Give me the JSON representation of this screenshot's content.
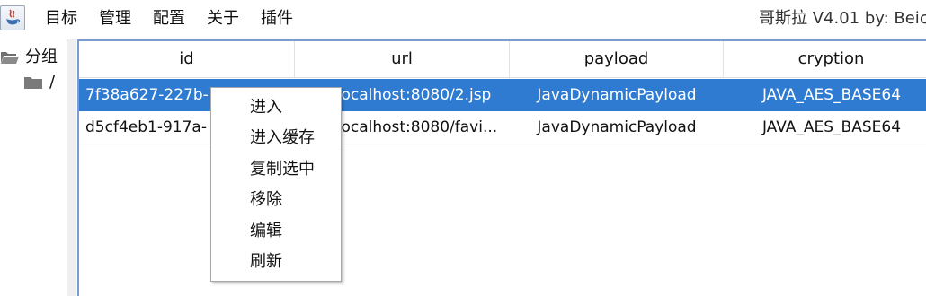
{
  "menubar": {
    "items": [
      "目标",
      "管理",
      "配置",
      "关于",
      "插件"
    ],
    "window_title": "哥斯拉   V4.01 by: Beic"
  },
  "tree": {
    "root_label": "分组",
    "child_label": "/"
  },
  "table": {
    "columns": [
      "id",
      "url",
      "payload",
      "cryption"
    ],
    "rows": [
      {
        "id": "7f38a627-227b-",
        "url": "/localhost:8080/2.jsp",
        "payload": "JavaDynamicPayload",
        "cryption": "JAVA_AES_BASE64",
        "selected": true
      },
      {
        "id": "d5cf4eb1-917a-",
        "url": "/localhost:8080/favi...",
        "payload": "JavaDynamicPayload",
        "cryption": "JAVA_AES_BASE64",
        "selected": false
      }
    ]
  },
  "context_menu": {
    "items": [
      "进入",
      "进入缓存",
      "复制选中",
      "移除",
      "编辑",
      "刷新"
    ]
  },
  "colors": {
    "selection": "#2f7bd2",
    "table_border": "#7a9cd3"
  }
}
